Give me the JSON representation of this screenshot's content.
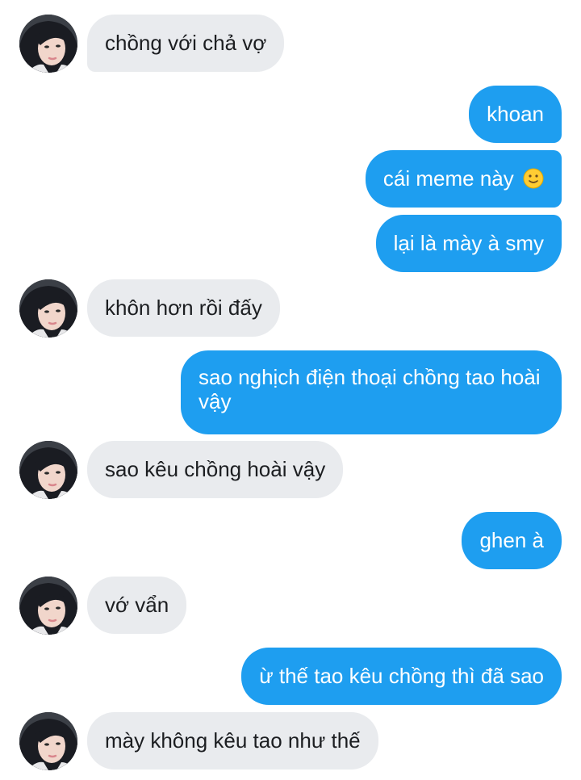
{
  "avatar": {
    "name": "contact-avatar",
    "skin": "#f1d6cb",
    "hair": "#1a1c22",
    "bg": "#3b3f46",
    "lip": "#d9868c"
  },
  "colors": {
    "incoming_bg": "#e9ebee",
    "outgoing_bg": "#1e9ef0"
  },
  "messages": [
    {
      "side": "in",
      "text": "chồng với chả vợ"
    },
    {
      "side": "out",
      "text": "khoan"
    },
    {
      "side": "out",
      "text": "cái meme này",
      "emoji": "slightly-smiling-face-icon"
    },
    {
      "side": "out",
      "text": "lại là mày à smy"
    },
    {
      "side": "in",
      "text": "khôn hơn rồi đấy"
    },
    {
      "side": "out",
      "text": "sao nghịch điện thoại chồng tao hoài vậy"
    },
    {
      "side": "in",
      "text": "sao kêu chồng hoài vậy"
    },
    {
      "side": "out",
      "text": "ghen à"
    },
    {
      "side": "in",
      "text": "vớ vẩn"
    },
    {
      "side": "out",
      "text": "ừ thế tao kêu chồng thì đã sao"
    },
    {
      "side": "in",
      "text": "mày không kêu tao như thế"
    }
  ]
}
